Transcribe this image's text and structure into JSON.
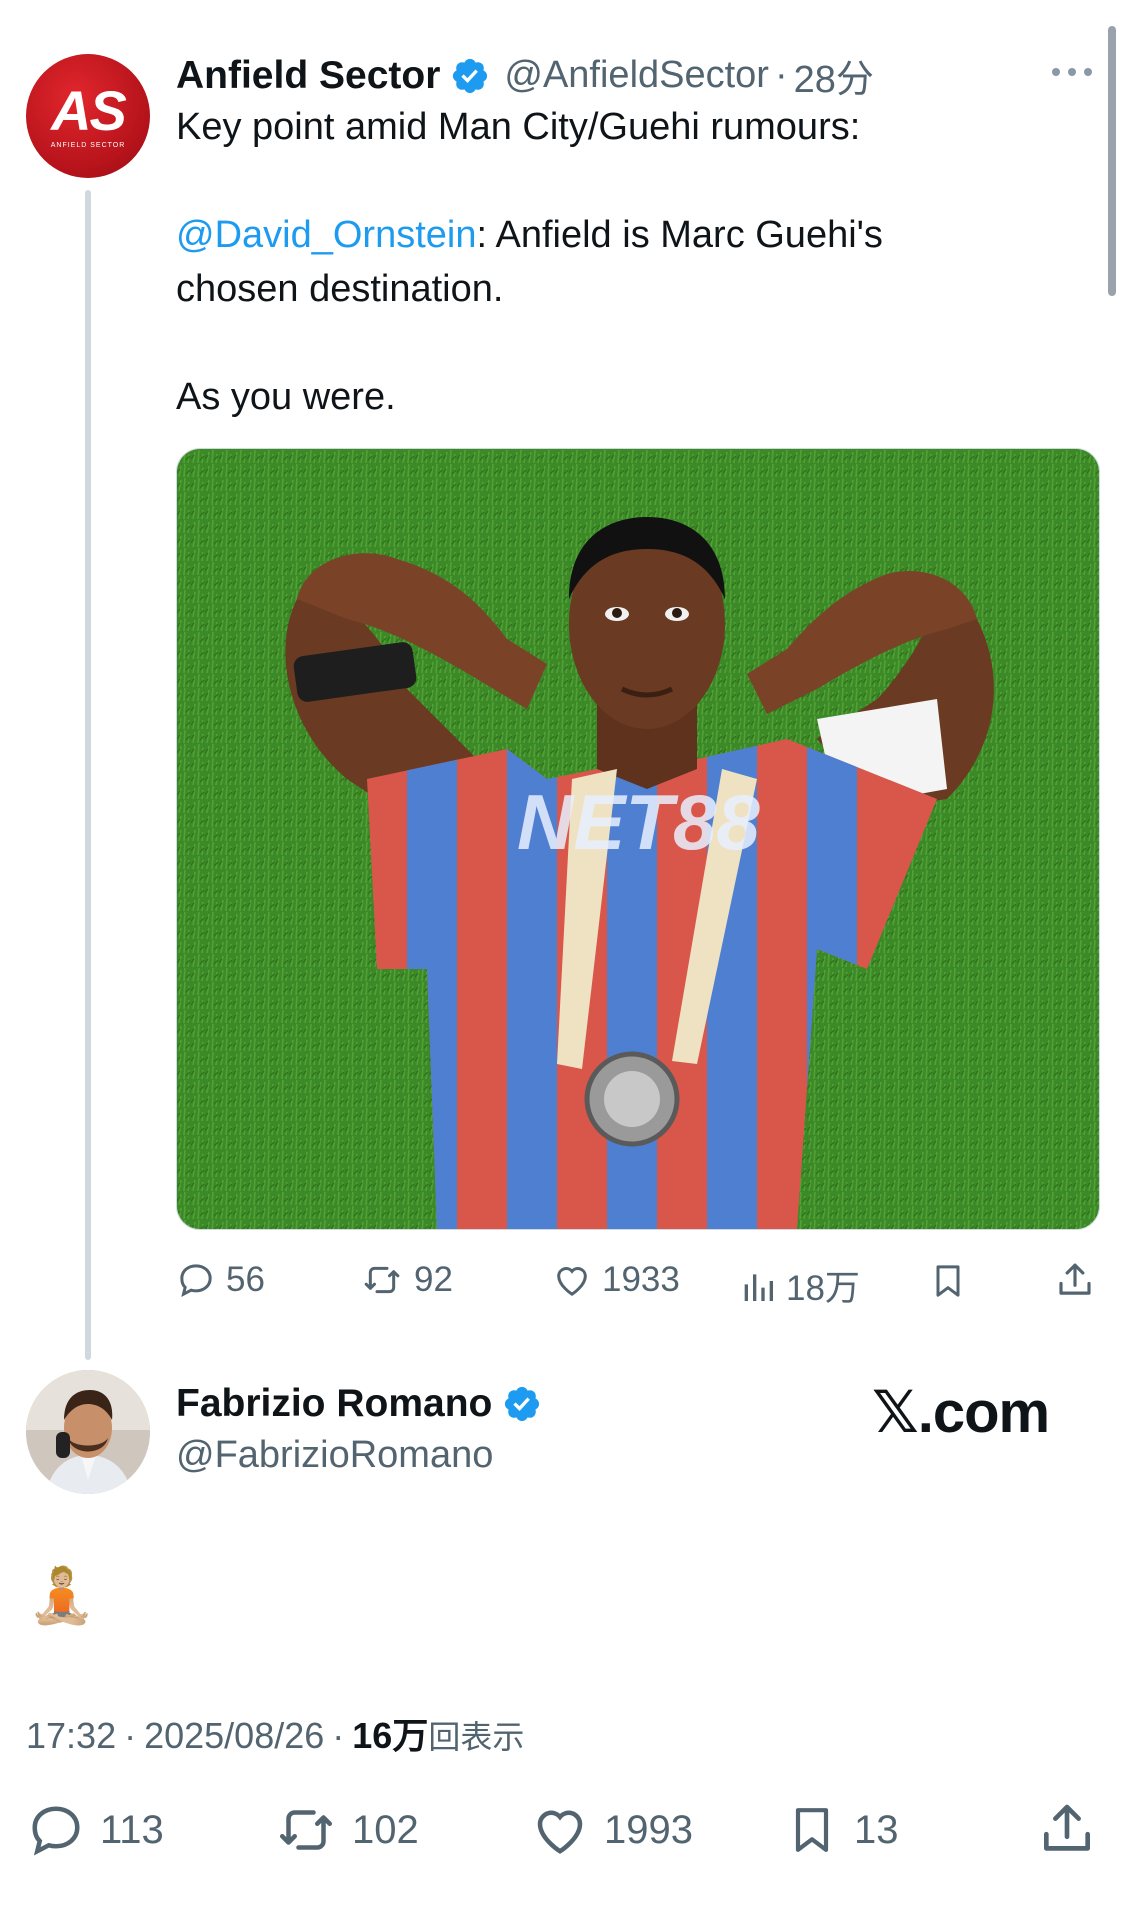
{
  "quoted_tweet": {
    "author_name": "Anfield Sector",
    "handle": "@AnfieldSector",
    "separator": "·",
    "time": "28分",
    "avatar_text": "AS",
    "avatar_subtext": "ANFIELD SECTOR",
    "text_line1": "Key point amid Man City/Guehi rumours:",
    "mention": "@David_Ornstein",
    "text_line2_rest": ": Anfield is Marc Guehi's",
    "text_line3": "chosen destination.",
    "text_line4": "As you were.",
    "shirt_sponsor": "NET88",
    "stats": {
      "replies": "56",
      "reposts": "92",
      "likes": "1933",
      "views": "18万"
    }
  },
  "main_tweet": {
    "author_name": "Fabrizio Romano",
    "handle": "@FabrizioRomano",
    "brand": "𝕏.com",
    "emoji": "🧘🏼",
    "time": "17:32",
    "dot1": "·",
    "date": "2025/08/26",
    "dot2": "·",
    "views_count": "16万",
    "views_label": "回表示",
    "stats": {
      "replies": "113",
      "reposts": "102",
      "likes": "1993",
      "bookmarks": "13"
    }
  },
  "colors": {
    "accent": "#1d9bf0",
    "verified": "#1d9bf0",
    "avatar_red": "#c8161d",
    "muted": "#536471"
  }
}
